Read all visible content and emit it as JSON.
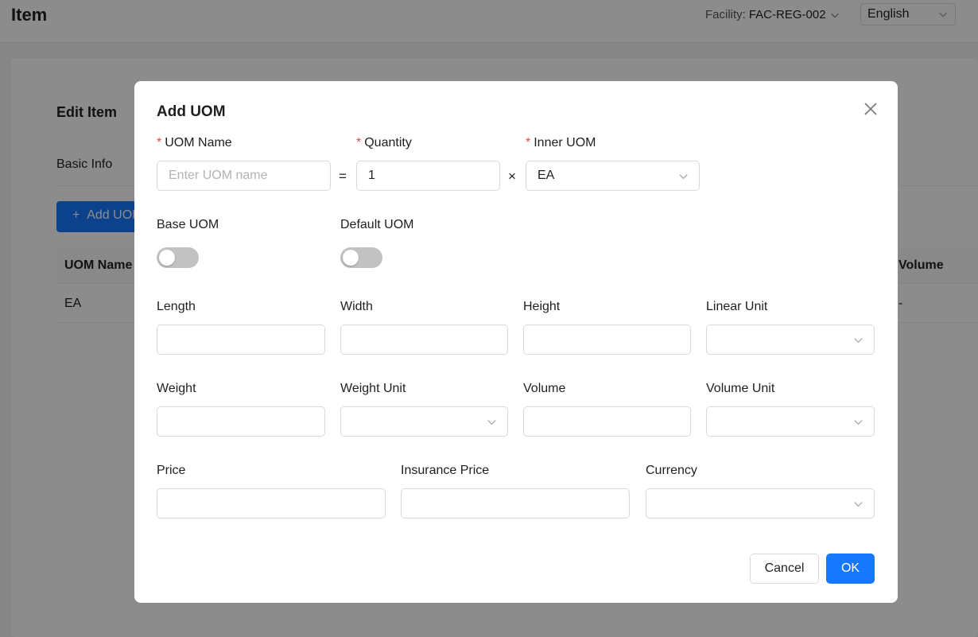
{
  "page": {
    "title": "Item",
    "facility_label": "Facility:",
    "facility_value": "FAC-REG-002",
    "language": "English"
  },
  "background": {
    "card_title": "Edit Item",
    "tab": "Basic Info",
    "add_button": "Add UOM",
    "table": {
      "headers": [
        "UOM Name",
        "Volume"
      ],
      "rows": [
        {
          "uom_name": "EA",
          "volume": "-"
        }
      ]
    }
  },
  "modal": {
    "title": "Add UOM",
    "required_mark": "*",
    "uom_name_label": "UOM Name",
    "uom_name_placeholder": "Enter UOM name",
    "uom_name_value": "",
    "equals": "=",
    "quantity_label": "Quantity",
    "quantity_value": "1",
    "times": "×",
    "inner_uom_label": "Inner UOM",
    "inner_uom_value": "EA",
    "base_uom_label": "Base UOM",
    "base_uom_on": false,
    "default_uom_label": "Default UOM",
    "default_uom_on": false,
    "length_label": "Length",
    "width_label": "Width",
    "height_label": "Height",
    "linear_unit_label": "Linear Unit",
    "weight_label": "Weight",
    "weight_unit_label": "Weight Unit",
    "volume_label": "Volume",
    "volume_unit_label": "Volume Unit",
    "price_label": "Price",
    "insurance_price_label": "Insurance Price",
    "currency_label": "Currency",
    "cancel_label": "Cancel",
    "ok_label": "OK"
  },
  "colors": {
    "primary": "#1677ff",
    "required": "#e5484d",
    "switch_off": "#c2c2c2"
  }
}
